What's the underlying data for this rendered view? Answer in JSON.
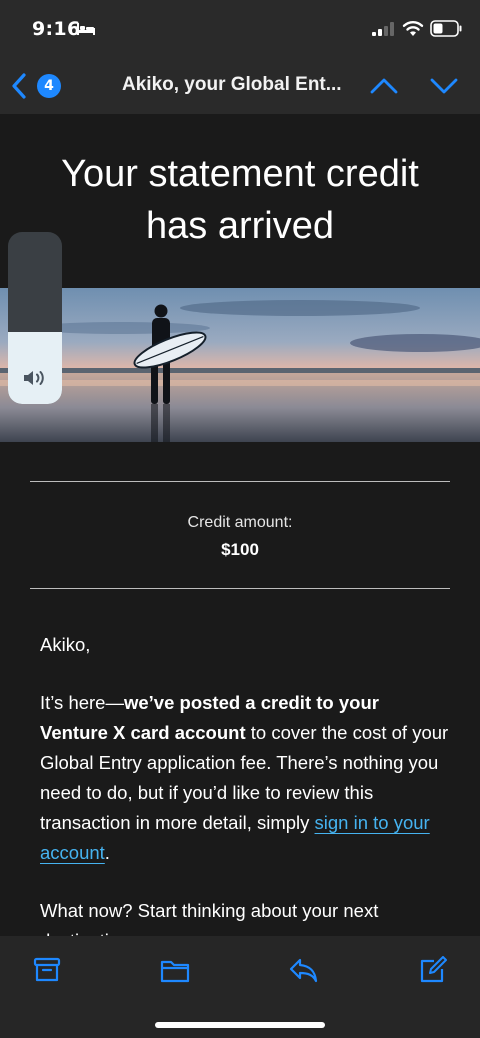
{
  "status_bar": {
    "time": "9:16"
  },
  "nav": {
    "unread_count": "4",
    "title": "Akiko, your Global Ent..."
  },
  "email": {
    "headline_line1": "Your statement credit",
    "headline_line2": "has arrived",
    "credit_label": "Credit amount:",
    "credit_value": "$100",
    "greeting": "Akiko,",
    "para_intro": "It’s here—",
    "para_bold": "we’ve posted a credit to your Venture X card account",
    "para_rest": " to cover the cost of your Global Entry application fee. There’s nothing you need to do, but if you’d like to review this transaction in more detail, simply ",
    "para_link": "sign in to your account",
    "para_end": ".",
    "para2": "What now? Start thinking about your next destination"
  },
  "volume": {
    "level_percent": 42
  },
  "colors": {
    "accent": "#1e88ff",
    "link": "#46b3f0",
    "background": "#1a1a1a",
    "bar": "#2a2a2a"
  },
  "icons": {
    "status": [
      "bed-icon",
      "signal-icon",
      "wifi-icon",
      "battery-icon"
    ],
    "toolbar": [
      "archive-icon",
      "folder-icon",
      "reply-icon",
      "compose-icon"
    ],
    "nav": [
      "back-chevron-icon",
      "up-chevron-icon",
      "down-chevron-icon"
    ]
  }
}
